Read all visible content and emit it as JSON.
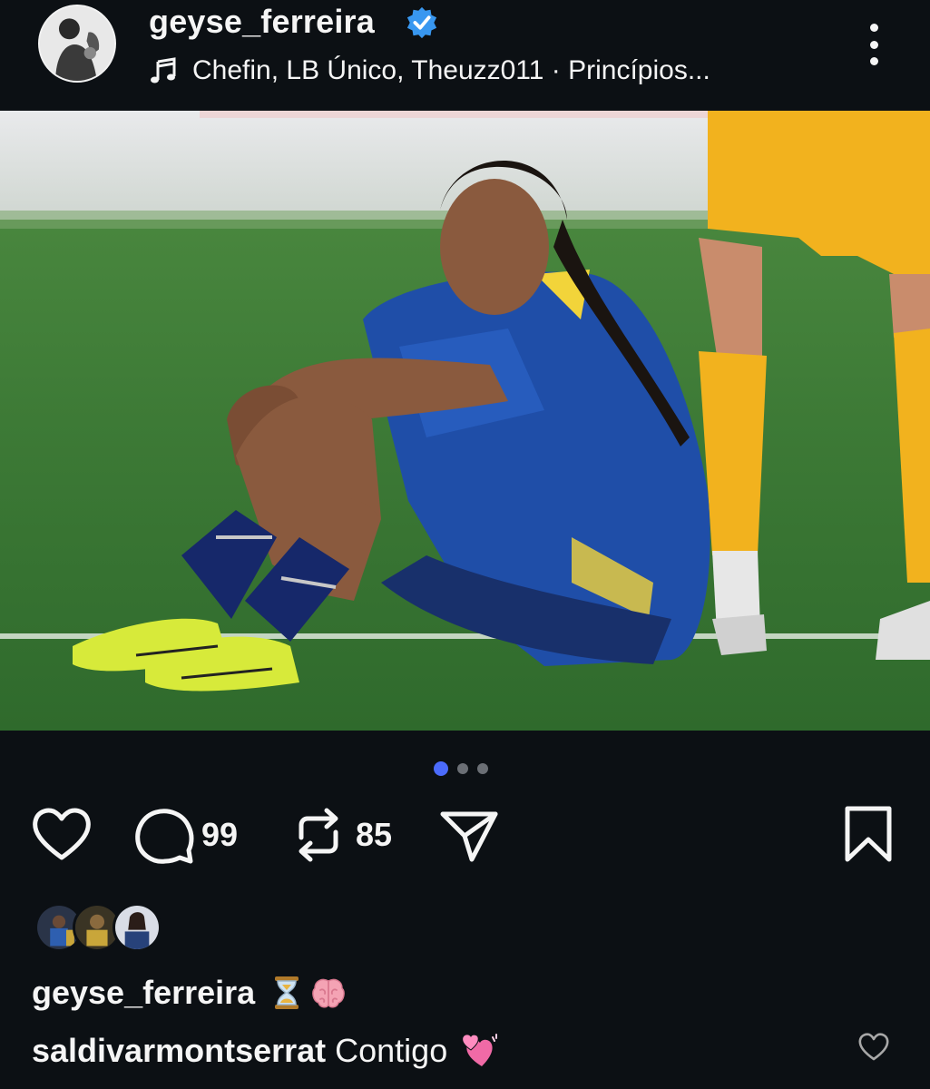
{
  "header": {
    "username": "geyse_ferreira",
    "verified_icon": "verified-badge-icon",
    "music": "Chefin, LB Único, Theuzz011 · Princípios..."
  },
  "carousel": {
    "total": 3,
    "active_index": 0
  },
  "actions": {
    "comments_count": "99",
    "reposts_count": "85"
  },
  "caption": {
    "user": "geyse_ferreira"
  },
  "comment": {
    "user": "saldivarmontserrat",
    "text": "Contigo"
  },
  "colors": {
    "background": "#0c1014",
    "accent": "#4b6bfb",
    "verified": "#3897f0"
  }
}
